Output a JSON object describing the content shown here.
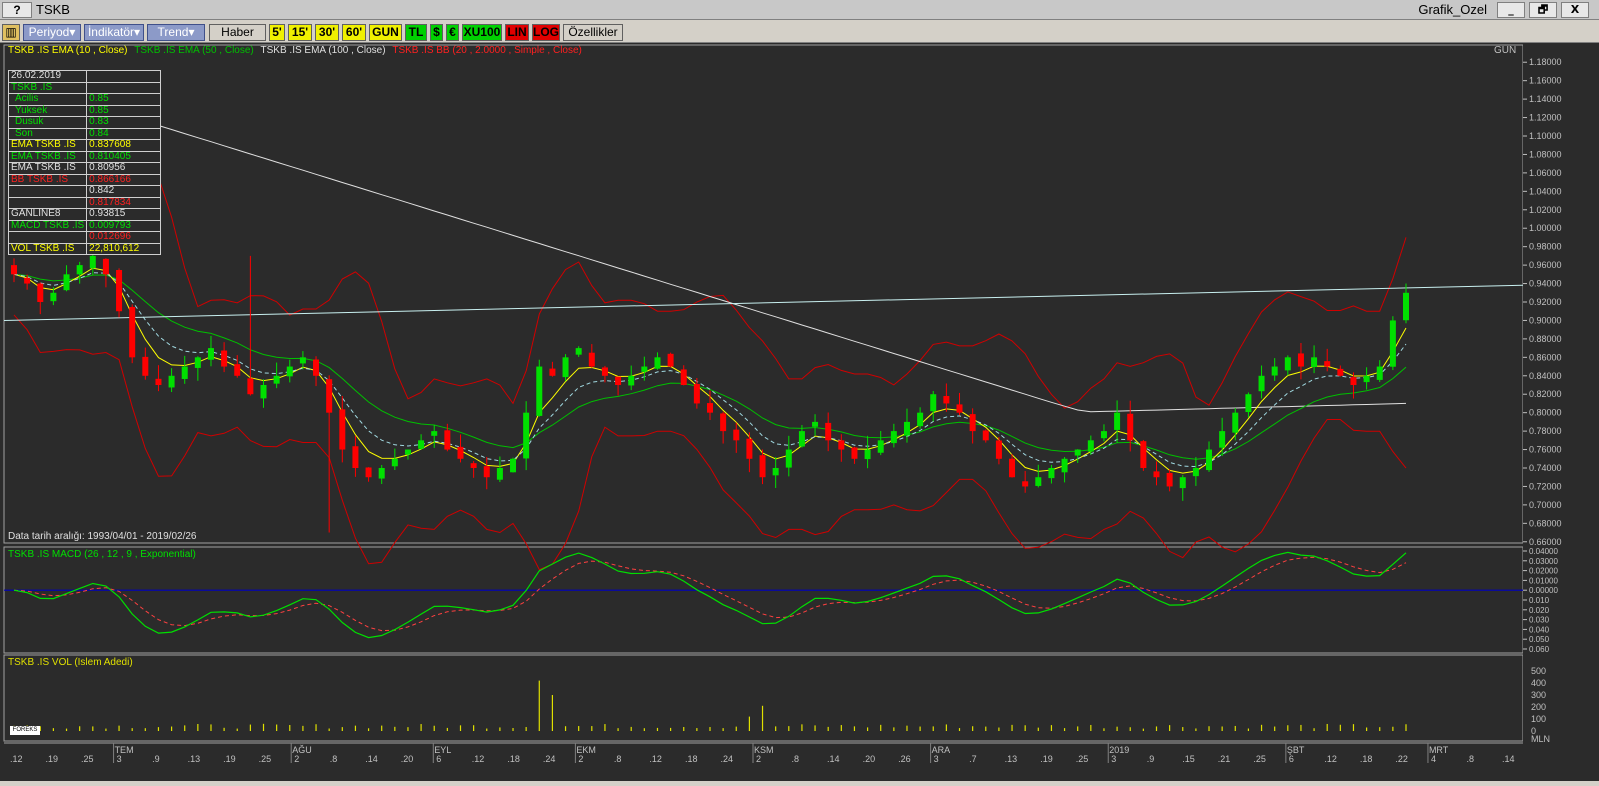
{
  "window": {
    "help_label": "?",
    "title": "TSKB",
    "right_title": "Grafik_Ozel",
    "min_label": "_",
    "restore_label": "🗗",
    "close_label": "X"
  },
  "toolbar": {
    "periyod": "Periyod",
    "indikator": "İndikatör",
    "trend": "Trend",
    "haber": "Haber",
    "p5": "5'",
    "p15": "15'",
    "p30": "30'",
    "p60": "60'",
    "gun": "GUN",
    "tl": "TL",
    "usd": "$",
    "eur": "€",
    "xu100": "XU100",
    "lin": "LIN",
    "log": "LOG",
    "ozellikler": "Özellikler"
  },
  "legend": {
    "ema10": "TSKB .IS EMA (10 , Close)",
    "ema50": "TSKB .IS EMA (50 , Close)",
    "ema100": "TSKB .IS EMA (100 , Close)",
    "bb": "TSKB .IS BB (20 , 2.0000 , Simple , Close)",
    "period": "GUN",
    "date_range": "Data tarih aralığı: 1993/04/01 - 2019/02/26",
    "macd": "TSKB .IS MACD (26 , 12 , 9 , Exponential)",
    "vol": "TSKB .IS VOL (Islem Adedi)",
    "logo": "FOREKS"
  },
  "info_table": {
    "date": "26.02.2019",
    "symbol": "TSKB .IS",
    "rows": [
      {
        "label": "Acilis",
        "value": "0.85"
      },
      {
        "label": "Yuksek",
        "value": "0.85"
      },
      {
        "label": "Dusuk",
        "value": "0.83"
      },
      {
        "label": "Son",
        "value": "0.84"
      },
      {
        "label": "EMA TSKB .IS",
        "value": "0.837608"
      },
      {
        "label": "EMA TSKB .IS",
        "value": "0.810405"
      },
      {
        "label": "EMA TSKB .IS",
        "value": "0.80956"
      },
      {
        "label": "BB TSKB .IS",
        "value": "0.866166"
      },
      {
        "label": "",
        "value": "0.842"
      },
      {
        "label": "",
        "value": "0.817834"
      },
      {
        "label": "GANLINE8",
        "value": "0.93815"
      },
      {
        "label": "MACD TSKB .IS",
        "value": "0.009793"
      },
      {
        "label": "",
        "value": "0.012696"
      },
      {
        "label": "VOL TSKB .IS",
        "value": "22,810,612"
      }
    ]
  },
  "colors": {
    "bg": "#2b2b2b",
    "up": "#00e000",
    "down": "#ff0000",
    "ema10": "#ffff00",
    "ema50": "#00c000",
    "ema100": "#e0e0e0",
    "bb": "#d00000",
    "trend": "#c8f0f0",
    "macd": "#00e000",
    "signal": "#ff4040",
    "zero": "#0000c0",
    "volume": "#e0e000"
  },
  "price_axis": [
    "1.18000",
    "1.16000",
    "1.14000",
    "1.12000",
    "1.10000",
    "1.08000",
    "1.06000",
    "1.04000",
    "1.02000",
    "1.00000",
    "0.98000",
    "0.96000",
    "0.94000",
    "0.92000",
    "0.90000",
    "0.88000",
    "0.86000",
    "0.84000",
    "0.82000",
    "0.80000",
    "0.78000",
    "0.76000",
    "0.74000",
    "0.72000",
    "0.70000",
    "0.68000",
    "0.66000"
  ],
  "macd_axis": [
    "0.04000",
    "0.03000",
    "0.02000",
    "0.01000",
    "0.00000",
    "0.010",
    "0.020",
    "0.030",
    "0.040",
    "0.050",
    "0.060"
  ],
  "vol_axis": [
    "500",
    "400",
    "300",
    "200",
    "100",
    "0",
    "MLN"
  ],
  "date_labels": [
    {
      "t": "12",
      "m": ""
    },
    {
      "t": "19",
      "m": ""
    },
    {
      "t": "25",
      "m": ""
    },
    {
      "t": "3",
      "m": "TEM"
    },
    {
      "t": "9",
      "m": ""
    },
    {
      "t": "13",
      "m": ""
    },
    {
      "t": "19",
      "m": ""
    },
    {
      "t": "25",
      "m": ""
    },
    {
      "t": "2",
      "m": "AĞU"
    },
    {
      "t": "8",
      "m": ""
    },
    {
      "t": "14",
      "m": ""
    },
    {
      "t": "20",
      "m": ""
    },
    {
      "t": "6",
      "m": "EYL"
    },
    {
      "t": "12",
      "m": ""
    },
    {
      "t": "18",
      "m": ""
    },
    {
      "t": "24",
      "m": ""
    },
    {
      "t": "2",
      "m": "EKM"
    },
    {
      "t": "8",
      "m": ""
    },
    {
      "t": "12",
      "m": ""
    },
    {
      "t": "18",
      "m": ""
    },
    {
      "t": "24",
      "m": ""
    },
    {
      "t": "2",
      "m": "KSM"
    },
    {
      "t": "8",
      "m": ""
    },
    {
      "t": "14",
      "m": ""
    },
    {
      "t": "20",
      "m": ""
    },
    {
      "t": "26",
      "m": ""
    },
    {
      "t": "3",
      "m": "ARA"
    },
    {
      "t": "7",
      "m": ""
    },
    {
      "t": "13",
      "m": ""
    },
    {
      "t": "19",
      "m": ""
    },
    {
      "t": "25",
      "m": ""
    },
    {
      "t": "3",
      "m": "2019"
    },
    {
      "t": "9",
      "m": ""
    },
    {
      "t": "15",
      "m": ""
    },
    {
      "t": "21",
      "m": ""
    },
    {
      "t": "25",
      "m": ""
    },
    {
      "t": "6",
      "m": "ŞBT"
    },
    {
      "t": "12",
      "m": ""
    },
    {
      "t": "18",
      "m": ""
    },
    {
      "t": "22",
      "m": ""
    },
    {
      "t": "4",
      "m": "MRT"
    },
    {
      "t": "8",
      "m": ""
    },
    {
      "t": "14",
      "m": ""
    }
  ],
  "chart_data": {
    "type": "candlestick",
    "period": "GUN",
    "price_range": [
      0.65,
      1.19
    ],
    "ohlc_close_sample": [
      0.95,
      0.94,
      0.92,
      0.93,
      0.95,
      0.96,
      0.97,
      0.95,
      0.91,
      0.86,
      0.84,
      0.83,
      0.84,
      0.85,
      0.86,
      0.87,
      0.85,
      0.84,
      0.82,
      0.83,
      0.84,
      0.85,
      0.86,
      0.84,
      0.8,
      0.76,
      0.74,
      0.73,
      0.74,
      0.75,
      0.76,
      0.77,
      0.78,
      0.76,
      0.75,
      0.74,
      0.73,
      0.74,
      0.75,
      0.8,
      0.85,
      0.84,
      0.86,
      0.87,
      0.85,
      0.84,
      0.83,
      0.84,
      0.85,
      0.86,
      0.85,
      0.83,
      0.81,
      0.8,
      0.78,
      0.77,
      0.75,
      0.73,
      0.74,
      0.76,
      0.78,
      0.79,
      0.77,
      0.76,
      0.75,
      0.76,
      0.77,
      0.78,
      0.79,
      0.8,
      0.82,
      0.81,
      0.8,
      0.78,
      0.77,
      0.75,
      0.73,
      0.72,
      0.73,
      0.74,
      0.75,
      0.76,
      0.77,
      0.78,
      0.8,
      0.77,
      0.74,
      0.73,
      0.72,
      0.73,
      0.74,
      0.76,
      0.78,
      0.8,
      0.82,
      0.84,
      0.85,
      0.86,
      0.85,
      0.86,
      0.85,
      0.84,
      0.83,
      0.84,
      0.85,
      0.9,
      0.93
    ],
    "ema100_final": 0.80956,
    "ema50_final": 0.810405,
    "ema10_final": 0.837608,
    "bb_upper_final": 0.866166,
    "bb_mid_final": 0.842,
    "bb_lower_final": 0.817834,
    "trendline_final": 0.93815,
    "macd_final": 0.009793,
    "signal_final": 0.012696,
    "macd_range": [
      -0.06,
      0.04
    ],
    "volume_range_mln": [
      0,
      500
    ],
    "volume_spikes_mln": [
      {
        "date": "18 EYL",
        "value": 420
      },
      {
        "date": "12 EKM",
        "value": 210
      }
    ]
  }
}
